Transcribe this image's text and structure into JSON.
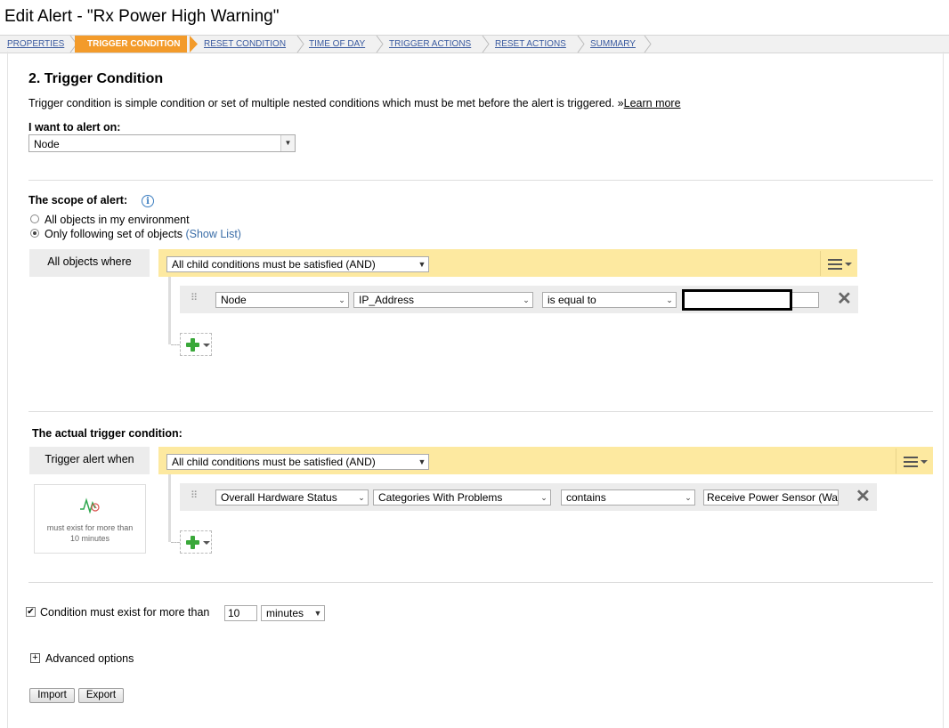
{
  "window": {
    "title": "Edit Alert - \"Rx Power High Warning\""
  },
  "wizard": {
    "steps": [
      {
        "label": "PROPERTIES"
      },
      {
        "label": "TRIGGER CONDITION"
      },
      {
        "label": "RESET CONDITION"
      },
      {
        "label": "TIME OF DAY"
      },
      {
        "label": "TRIGGER ACTIONS"
      },
      {
        "label": "RESET ACTIONS"
      },
      {
        "label": "SUMMARY"
      }
    ],
    "active_index": 1
  },
  "section": {
    "title": "2. Trigger Condition",
    "description": "Trigger condition is simple condition or set of multiple nested conditions which must be met before the alert is triggered. »",
    "learn_more": "Learn more"
  },
  "alert_on": {
    "label": "I want to alert on:",
    "value": "Node"
  },
  "scope": {
    "label": "The scope of alert:",
    "info_icon": "info-icon",
    "options": [
      {
        "label": "All objects in my environment",
        "selected": false
      },
      {
        "label": "Only following set of objects",
        "selected": true
      }
    ],
    "show_list": "(Show List)",
    "group_label": "All objects where",
    "group_condition": "All child conditions must be satisfied (AND)",
    "condition": {
      "entity": "Node",
      "field": "IP_Address",
      "operator": "is equal to",
      "value": ""
    }
  },
  "trigger": {
    "label": "The actual trigger condition:",
    "group_label": "Trigger alert when",
    "group_condition": "All child conditions must be satisfied (AND)",
    "card_text": "must exist for more than 10 minutes",
    "condition": {
      "entity": "Overall Hardware Status",
      "field": "Categories With Problems",
      "operator": "contains",
      "value": "Receive Power Sensor (Wa"
    }
  },
  "duration": {
    "checked": true,
    "label": "Condition must exist for more than",
    "value": "10",
    "unit": "minutes"
  },
  "advanced": {
    "label": "Advanced options"
  },
  "buttons": {
    "import": "Import",
    "export": "Export"
  },
  "colors": {
    "active_step": "#f39b2a",
    "group_bar": "#fde9a0",
    "link": "#3b5ba0",
    "add_icon": "#3aa83a"
  }
}
